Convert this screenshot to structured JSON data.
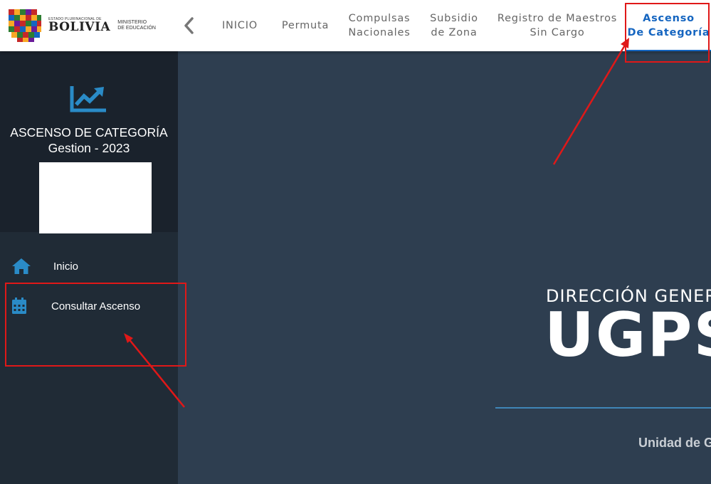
{
  "header": {
    "logo": {
      "small_text": "ESTADO PLURINACIONAL DE",
      "big_text": "BOLIVIA",
      "ministry": [
        "MINISTERIO",
        "DE EDUCACIÓN"
      ]
    },
    "nav": [
      {
        "line1": "INICIO",
        "line2": ""
      },
      {
        "line1": "Permuta",
        "line2": ""
      },
      {
        "line1": "Compulsas",
        "line2": "Nacionales"
      },
      {
        "line1": "Subsidio",
        "line2": "de Zona"
      },
      {
        "line1": "Registro de Maestros",
        "line2": "Sin Cargo"
      },
      {
        "line1": "Ascenso",
        "line2": "De Categoría"
      }
    ],
    "active_index": 5
  },
  "sidebar": {
    "title": "ASCENSO DE CATEGORÍA",
    "subtitle": "Gestion - 2023",
    "menu": [
      {
        "label": "Inicio",
        "icon": "home-icon"
      },
      {
        "label": "Consultar Ascenso",
        "icon": "calendar-icon"
      }
    ]
  },
  "main": {
    "heading": "DIRECCIÓN GENERAL",
    "big": "UGPSEP",
    "unidad": "Unidad de Gestión"
  },
  "colors": {
    "accent": "#1565c0",
    "sidebar_icon": "#2a8bc7",
    "annotation": "#e01818",
    "main_bg": "#2e3e50"
  }
}
